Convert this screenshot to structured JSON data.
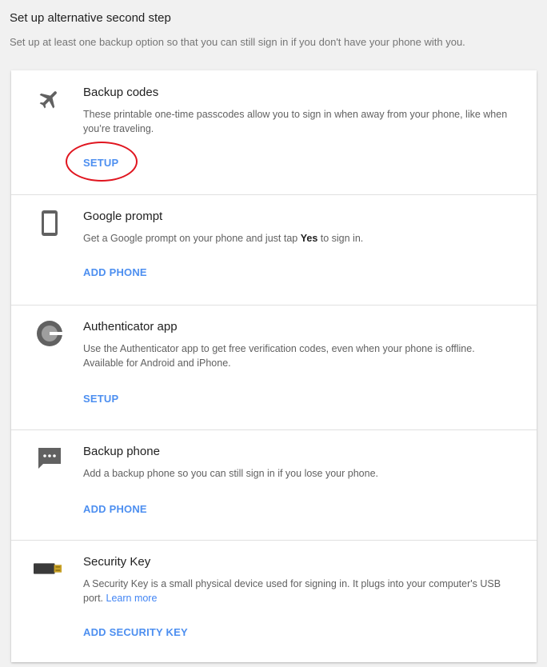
{
  "header": {
    "title": "Set up alternative second step",
    "subtitle": "Set up at least one backup option so that you can still sign in if you don't have your phone with you."
  },
  "options": [
    {
      "title": "Backup codes",
      "description": "These printable one-time passcodes allow you to sign in when away from your phone, like when you’re traveling.",
      "action": "SETUP",
      "icon": "airplane-icon"
    },
    {
      "title": "Google prompt",
      "description_before": "Get a Google prompt on your phone and just tap ",
      "description_bold": "Yes",
      "description_after": " to sign in.",
      "action": "ADD PHONE",
      "icon": "phone-icon"
    },
    {
      "title": "Authenticator app",
      "description": "Use the Authenticator app to get free verification codes, even when your phone is offline. Available for Android and iPhone.",
      "action": "SETUP",
      "icon": "authenticator-icon"
    },
    {
      "title": "Backup phone",
      "description": "Add a backup phone so you can still sign in if you lose your phone.",
      "action": "ADD PHONE",
      "icon": "message-icon"
    },
    {
      "title": "Security Key",
      "description_before": "A Security Key is a small physical device used for signing in. It plugs into your computer's USB port. ",
      "description_link": "Learn more",
      "action": "ADD SECURITY KEY",
      "icon": "usb-key-icon"
    }
  ],
  "colors": {
    "accent": "#4d8ff0",
    "highlight": "#e0151f",
    "icon": "#616161"
  }
}
